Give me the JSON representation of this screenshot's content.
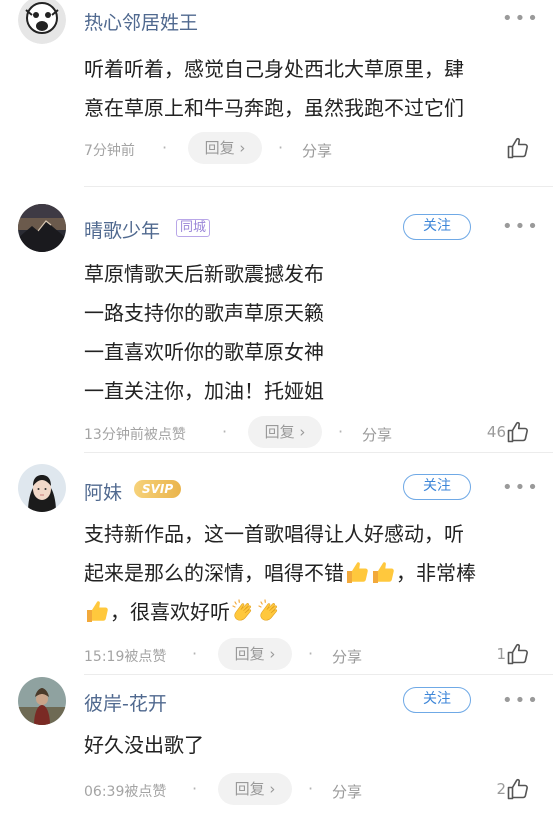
{
  "colors": {
    "name": "#50698f",
    "follow": "#3d86d8",
    "meta": "#a4a4a4"
  },
  "comments": [
    {
      "name": "热心邻居姓王",
      "text": [
        "听着听着，感觉自己身处西北大草原里，肆",
        "意在草原上和牛马奔跑，虽然我跑不过它们"
      ],
      "time": "7分钟前",
      "reply": "回复",
      "share": "分享",
      "likes": ""
    },
    {
      "name": "晴歌少年",
      "badge": "同城",
      "follow": "关注",
      "text": [
        "草原情歌天后新歌震撼发布",
        "一路支持你的歌声草原天籁",
        "一直喜欢听你的歌草原女神",
        "一直关注你，加油！托娅姐"
      ],
      "time": "13分钟前被点赞",
      "reply": "回复",
      "share": "分享",
      "likes": "46"
    },
    {
      "name": "阿妹",
      "badge": "SVIP",
      "follow": "关注",
      "text": [
        "支持新作品，这一首歌唱得让人好感动，听",
        "起来是那么的深情，唱得不错",
        "，非常棒",
        "，很喜欢好听"
      ],
      "time": "15:19被点赞",
      "reply": "回复",
      "share": "分享",
      "likes": "1"
    },
    {
      "name": "彼岸-花开",
      "follow": "关注",
      "text": [
        "好久没出歌了"
      ],
      "time": "06:39被点赞",
      "reply": "回复",
      "share": "分享",
      "likes": "2"
    }
  ],
  "icons": {
    "more": "more-dots-icon",
    "like": "thumbs-up-icon",
    "reply_arrow": "chevron-right-icon",
    "thumb_emoji": "thumbs-up-emoji",
    "clap_emoji": "clapping-hands-emoji"
  }
}
